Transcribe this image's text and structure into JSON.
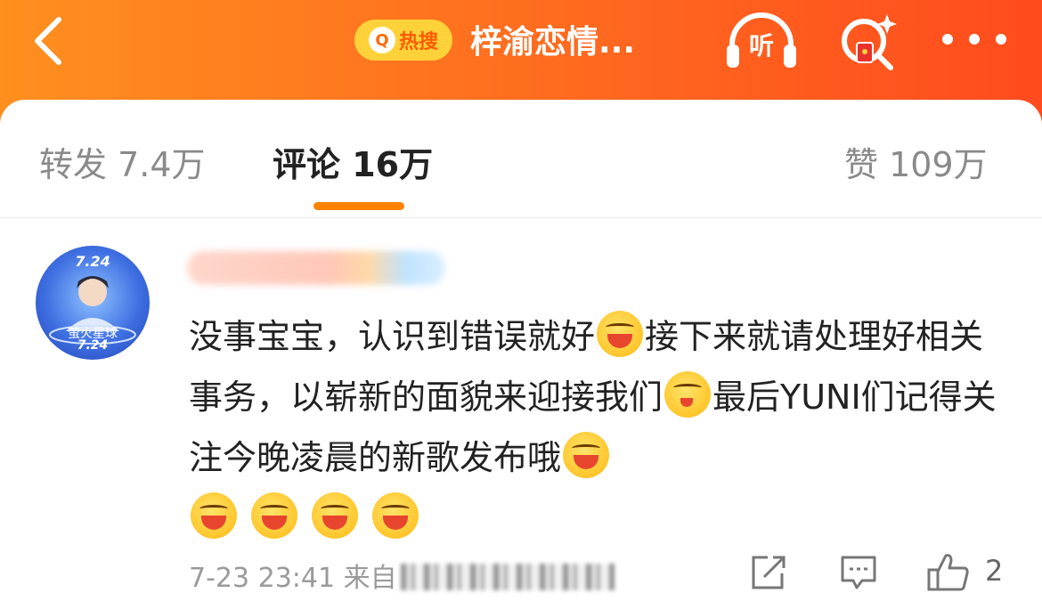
{
  "header": {
    "hot_search_label": "热搜",
    "title": "梓渝恋情...",
    "listen_label": "听"
  },
  "tabs": {
    "repost": "转发 7.4万",
    "comment": "评论 16万",
    "like": "赞 109万"
  },
  "comment": {
    "avatar": {
      "date_top": "7.24",
      "date_bottom": "7.24",
      "badge_text": "萤火星球"
    },
    "text": {
      "part1": "没事宝宝，认识到错误就好",
      "part2": "接下来就请处理好相关事务，以崭新的面貌来迎接我们",
      "part3": "最后YUNI们记得关注今晚凌晨的新歌发布哦"
    },
    "time": "7-23 23:41",
    "source_prefix": "来自",
    "like_count": "2"
  },
  "colors": {
    "accent": "#ff8200",
    "topbar_start": "#ff8f1f",
    "topbar_end": "#ff4b1d",
    "hot_pill": "#ffd23a"
  },
  "icons": [
    "back-arrow-icon",
    "search-icon",
    "headphones-icon",
    "search-gift-icon",
    "more-icon",
    "share-icon",
    "comment-icon",
    "thumbs-up-icon"
  ]
}
